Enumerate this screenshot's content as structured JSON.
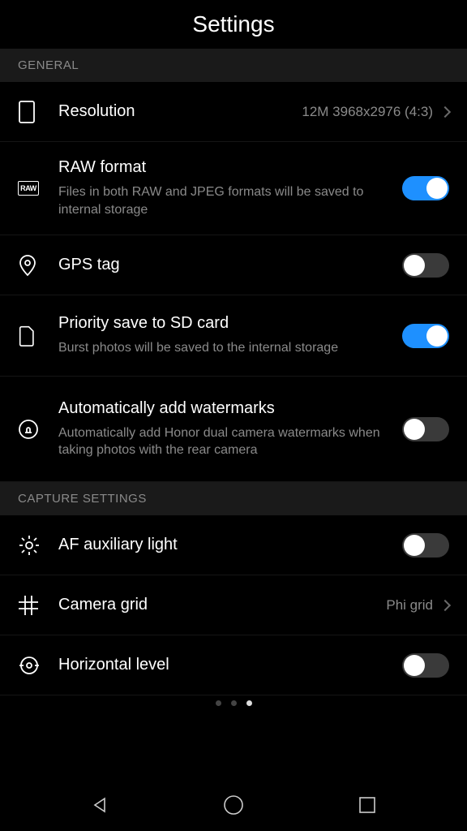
{
  "header": {
    "title": "Settings"
  },
  "sections": {
    "general": {
      "label": "GENERAL",
      "resolution": {
        "title": "Resolution",
        "value": "12M 3968x2976 (4:3)"
      },
      "raw": {
        "title": "RAW format",
        "sub": "Files in both RAW and JPEG formats will be saved to internal storage",
        "on": true
      },
      "gps": {
        "title": "GPS tag",
        "on": false
      },
      "sd": {
        "title": "Priority save to SD card",
        "sub": "Burst photos will be saved to the internal storage",
        "on": true
      },
      "wm": {
        "title": "Automatically add watermarks",
        "sub": "Automatically add Honor dual camera watermarks when taking photos with the rear camera",
        "on": false
      }
    },
    "capture": {
      "label": "CAPTURE SETTINGS",
      "af": {
        "title": "AF auxiliary light",
        "on": false
      },
      "grid": {
        "title": "Camera grid",
        "value": "Phi grid"
      },
      "level": {
        "title": "Horizontal level",
        "on": false
      }
    }
  },
  "icons": {
    "raw_label": "RAW"
  },
  "pager": {
    "count": 3,
    "active": 2
  }
}
